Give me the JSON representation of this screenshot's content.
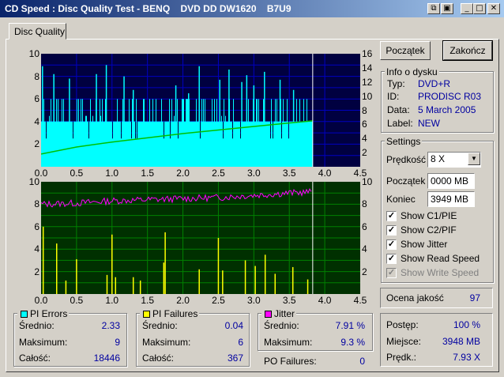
{
  "window": {
    "title": "CD Speed : Disc Quality Test - BENQ    DVD DD DW1620    B7U9",
    "controls": {
      "icon1": "⧉",
      "icon2": "▣",
      "minimize": "_",
      "maximize": "□",
      "close": "✕"
    }
  },
  "tabs": [
    "Disc Quality"
  ],
  "chart_data": [
    {
      "type": "bar",
      "name": "PI Errors chart",
      "x_ticks": [
        "0.0",
        "0.5",
        "1.0",
        "1.5",
        "2.0",
        "2.5",
        "3.0",
        "3.5",
        "4.0",
        "4.5"
      ],
      "y_left_ticks": [
        "2",
        "4",
        "6",
        "8",
        "10"
      ],
      "y_right_ticks": [
        "2",
        "4",
        "6",
        "8",
        "10",
        "12",
        "14",
        "16"
      ],
      "xlim": [
        0,
        4.5
      ],
      "ylim_left": [
        0,
        10
      ],
      "ylim_right": [
        0,
        16
      ],
      "end_marker_x": 3.83,
      "colors": {
        "background": "#000040",
        "grid": "#0000c0",
        "bars": "#00ffff",
        "speed": "#00c000",
        "marker": "#ffffff"
      },
      "series": [
        {
          "values_summary": {
            "average": 2.33,
            "max": 9,
            "total": 18446
          },
          "spikes": [
            [
              0.02,
              8.9
            ],
            [
              0.18,
              8.2
            ],
            [
              0.4,
              7.8
            ],
            [
              0.78,
              8.2
            ],
            [
              0.92,
              9
            ],
            [
              1.17,
              8
            ],
            [
              1.3,
              6.8
            ],
            [
              1.9,
              7.2
            ],
            [
              2.08,
              6.5
            ],
            [
              2.23,
              8.9
            ],
            [
              2.52,
              7.7
            ],
            [
              2.65,
              8.6
            ],
            [
              2.83,
              7.5
            ],
            [
              2.9,
              8.1
            ],
            [
              3.0,
              7.2
            ],
            [
              3.15,
              8.4
            ],
            [
              3.37,
              7.7
            ],
            [
              3.56,
              6.8
            ]
          ]
        },
        {
          "speed": [
            [
              0.0,
              1.8
            ],
            [
              0.5,
              2.8
            ],
            [
              1.0,
              3.5
            ],
            [
              1.5,
              4.1
            ],
            [
              2.0,
              4.7
            ],
            [
              2.5,
              5.2
            ],
            [
              3.0,
              5.7
            ],
            [
              3.5,
              6.2
            ],
            [
              3.83,
              6.5
            ]
          ]
        }
      ]
    },
    {
      "type": "line",
      "name": "PI Failures chart",
      "x_ticks": [
        "0.0",
        "0.5",
        "1.0",
        "1.5",
        "2.0",
        "2.5",
        "3.0",
        "3.5",
        "4.0",
        "4.5"
      ],
      "y_left_ticks": [
        "2",
        "4",
        "6",
        "8",
        "10"
      ],
      "y_right_ticks": [
        "2",
        "4",
        "6",
        "8",
        "10"
      ],
      "xlim": [
        0,
        4.5
      ],
      "ylim": [
        0,
        10
      ],
      "end_marker_x": 3.83,
      "colors": {
        "background": "#003000",
        "grid": "#008000",
        "failures": "#ffff00",
        "jitter": "#ff00ff",
        "marker": "#ffffff"
      },
      "series": [
        {
          "values_summary": {
            "average": 0.04,
            "max": 6,
            "total": 367
          },
          "spikes": [
            [
              0.03,
              6
            ],
            [
              0.22,
              4.5
            ],
            [
              0.35,
              1.2
            ],
            [
              0.5,
              3.1
            ],
            [
              0.93,
              1.7
            ],
            [
              1.0,
              5.3
            ],
            [
              1.05,
              1.5
            ],
            [
              1.3,
              1.5
            ],
            [
              1.4,
              1.2
            ],
            [
              1.73,
              2.8
            ],
            [
              1.75,
              5.5
            ],
            [
              2.23,
              2.2
            ],
            [
              2.5,
              5
            ],
            [
              2.56,
              2.1
            ],
            [
              2.88,
              3
            ],
            [
              3.02,
              2.5
            ],
            [
              3.16,
              3.5
            ],
            [
              3.3,
              1.8
            ],
            [
              3.55,
              2.4
            ],
            [
              3.76,
              1.3
            ]
          ]
        },
        {
          "jitter": [
            [
              0.0,
              8.0
            ],
            [
              0.5,
              8.1
            ],
            [
              1.0,
              8.3
            ],
            [
              1.5,
              8.4
            ],
            [
              2.0,
              8.5
            ],
            [
              2.5,
              8.6
            ],
            [
              3.0,
              8.8
            ],
            [
              3.5,
              9.0
            ],
            [
              3.83,
              9.1
            ]
          ]
        }
      ]
    }
  ],
  "buttons": {
    "start": "Początek",
    "end": "Zakończ"
  },
  "info": {
    "title": "Info o dysku",
    "rows": [
      {
        "label": "Typ:",
        "value": "DVD+R"
      },
      {
        "label": "ID:",
        "value": "PRODISC R03"
      },
      {
        "label": "Data:",
        "value": "5 March 2005"
      },
      {
        "label": "Label:",
        "value": "NEW"
      }
    ]
  },
  "settings": {
    "title": "Settings",
    "speed_label": "Prędkość",
    "speed_value": "8 X",
    "start_label": "Początek",
    "start_value": "0000 MB",
    "end_label": "Koniec",
    "end_value": "3949 MB",
    "checks": [
      {
        "label": "Show C1/PIE",
        "checked": true,
        "enabled": true
      },
      {
        "label": "Show C2/PIF",
        "checked": true,
        "enabled": true
      },
      {
        "label": "Show Jitter",
        "checked": true,
        "enabled": true
      },
      {
        "label": "Show Read Speed",
        "checked": true,
        "enabled": true
      },
      {
        "label": "Show Write Speed",
        "checked": true,
        "enabled": false
      }
    ]
  },
  "quality": {
    "label": "Ocena jakość",
    "value": "97"
  },
  "progress": {
    "rows": [
      {
        "label": "Postęp:",
        "value": "100 %"
      },
      {
        "label": "Miejsce:",
        "value": "3948 MB"
      },
      {
        "label": "Prędk.:",
        "value": "7.93 X"
      }
    ]
  },
  "stats": {
    "pie": {
      "title": "PI Errors",
      "color": "#00ffff",
      "rows": [
        {
          "label": "Średnio:",
          "value": "2.33"
        },
        {
          "label": "Maksimum:",
          "value": "9"
        },
        {
          "label": "Całość:",
          "value": "18446"
        }
      ]
    },
    "pif": {
      "title": "PI Failures",
      "color": "#ffff00",
      "rows": [
        {
          "label": "Średnio:",
          "value": "0.04"
        },
        {
          "label": "Maksimum:",
          "value": "6"
        },
        {
          "label": "Całość:",
          "value": "367"
        }
      ]
    },
    "jitter": {
      "title": "Jitter",
      "color": "#ff00ff",
      "rows": [
        {
          "label": "Średnio:",
          "value": "7.91 %"
        },
        {
          "label": "Maksimum:",
          "value": "9.3 %"
        }
      ]
    },
    "po": {
      "label": "PO Failures:",
      "value": "0"
    }
  }
}
